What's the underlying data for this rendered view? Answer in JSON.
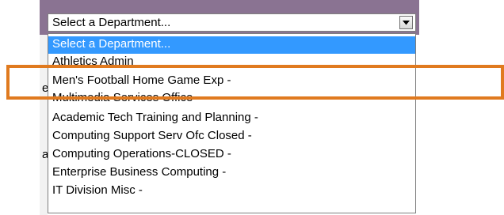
{
  "select": {
    "value": "Select a Department...",
    "arrow_icon": "chevron-down-icon"
  },
  "options": [
    "Select a Department...",
    "Athletics Admin",
    "Men's Football Home Game Exp -",
    "Multimedia Services Office -",
    "Academic Tech Training and Planning -",
    "Computing Support Serv Ofc Closed -",
    "Computing Operations-CLOSED -",
    "Enterprise Business Computing -",
    "IT Division Misc -"
  ],
  "selected_index": 0,
  "background_chars": {
    "first": "e",
    "second": "a"
  },
  "colors": {
    "header_bar": "#8a7392",
    "selection": "#3399ff",
    "highlight_box": "#e07a1f"
  }
}
